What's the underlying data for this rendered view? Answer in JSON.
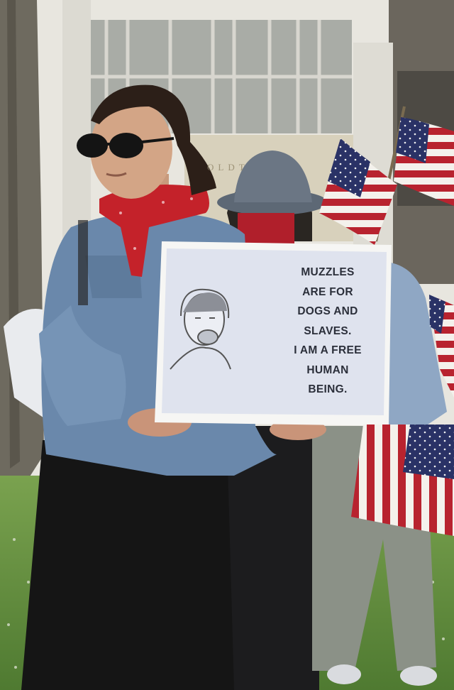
{
  "photo": {
    "sign": {
      "lines": [
        "MUZZLES",
        "ARE FOR",
        "DOGS AND",
        "SLAVES.",
        "I AM A FREE",
        "HUMAN",
        "BEING."
      ]
    },
    "building_lettering": "OLDT",
    "colors": {
      "sky_wall": "#e8e6df",
      "grass": "#5f8a3c",
      "denim": "#6a88ab",
      "skirt": "#151515",
      "bandana": "#c4222a",
      "flag_red": "#b8232f",
      "flag_blue": "#2a3266"
    }
  }
}
